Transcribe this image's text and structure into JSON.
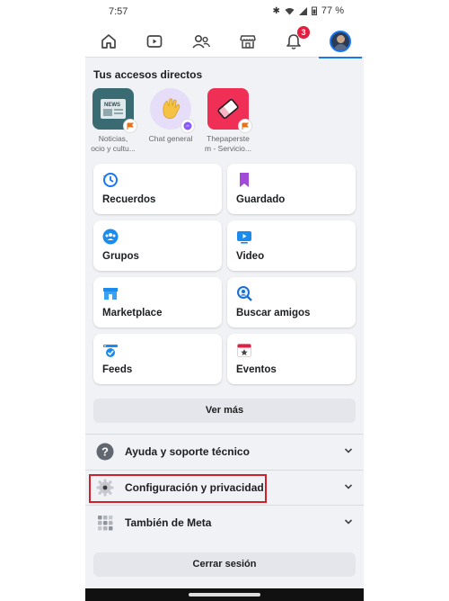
{
  "status_bar": {
    "time": "7:57",
    "battery": "77 %"
  },
  "nav": {
    "tabs": [
      "home-icon",
      "watch-icon",
      "friends-icon",
      "marketplace-icon",
      "notifications-icon",
      "menu-avatar"
    ],
    "notification_count": "3"
  },
  "shortcuts": {
    "title": "Tus accesos directos",
    "items": [
      {
        "label_line1": "Noticias,",
        "label_line2": "ocio y cultu...",
        "icon": "news-icon"
      },
      {
        "label_line1": "Chat general",
        "label_line2": "",
        "icon": "wave-hand-icon"
      },
      {
        "label_line1": "Thepaperste",
        "label_line2": "m - Servicio...",
        "icon": "eraser-icon"
      }
    ]
  },
  "grid": [
    {
      "label": "Recuerdos",
      "icon": "memories-icon"
    },
    {
      "label": "Guardado",
      "icon": "saved-icon"
    },
    {
      "label": "Grupos",
      "icon": "groups-icon"
    },
    {
      "label": "Video",
      "icon": "video-icon"
    },
    {
      "label": "Marketplace",
      "icon": "marketplace-icon"
    },
    {
      "label": "Buscar amigos",
      "icon": "find-friends-icon"
    },
    {
      "label": "Feeds",
      "icon": "feeds-icon"
    },
    {
      "label": "Eventos",
      "icon": "events-icon"
    }
  ],
  "see_more": "Ver más",
  "sections": [
    {
      "label": "Ayuda y soporte técnico",
      "icon": "help-icon"
    },
    {
      "label": "Configuración y privacidad",
      "icon": "gear-icon"
    },
    {
      "label": "También de Meta",
      "icon": "meta-grid-icon"
    }
  ],
  "logout": "Cerrar sesión",
  "colors": {
    "accent": "#1877f2",
    "highlight": "#d0212a",
    "badge": "#e41e3f"
  }
}
